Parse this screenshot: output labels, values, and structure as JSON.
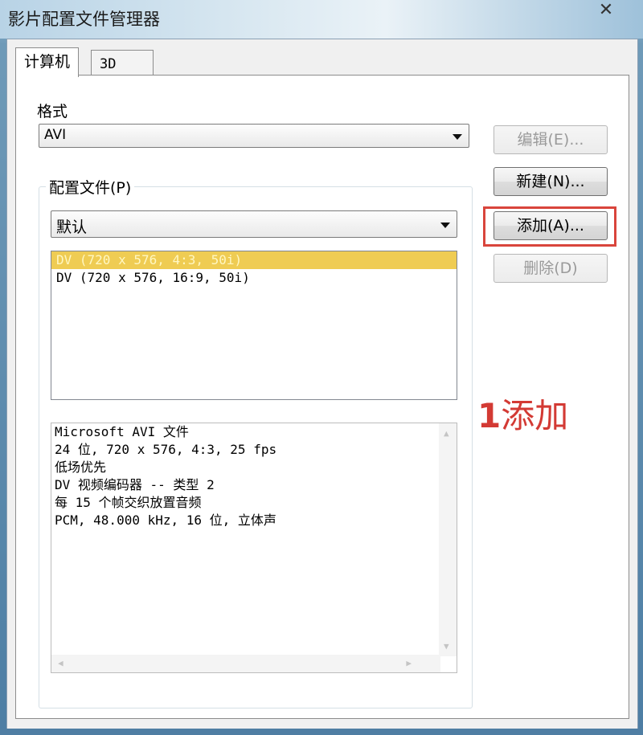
{
  "window": {
    "title": "影片配置文件管理器",
    "close_label": "✕"
  },
  "tabs": [
    {
      "label": "计算机",
      "active": true
    },
    {
      "label": "3D",
      "active": false
    }
  ],
  "format": {
    "label": "格式",
    "selected": "AVI"
  },
  "profile_group": {
    "title": "配置文件(P)",
    "selected": "默认",
    "items": [
      {
        "text": "DV (720 x 576, 4:3, 50i)",
        "selected": true
      },
      {
        "text": "DV (720 x 576, 16:9, 50i)",
        "selected": false
      }
    ]
  },
  "info": {
    "lines": [
      "Microsoft AVI 文件",
      "24 位, 720 x 576, 4:3, 25 fps",
      "低场优先",
      "DV 视频编码器 -- 类型 2",
      "每 15 个帧交织放置音频",
      "PCM, 48.000 kHz, 16 位, 立体声"
    ]
  },
  "buttons": {
    "edit": "编辑(E)...",
    "new": "新建(N)...",
    "add": "添加(A)...",
    "delete": "删除(D)"
  },
  "annotation": {
    "number": "1",
    "text": "添加",
    "color": "#d33a34"
  },
  "colors": {
    "selection": "#efcc53",
    "highlight_border": "#d9453c"
  }
}
